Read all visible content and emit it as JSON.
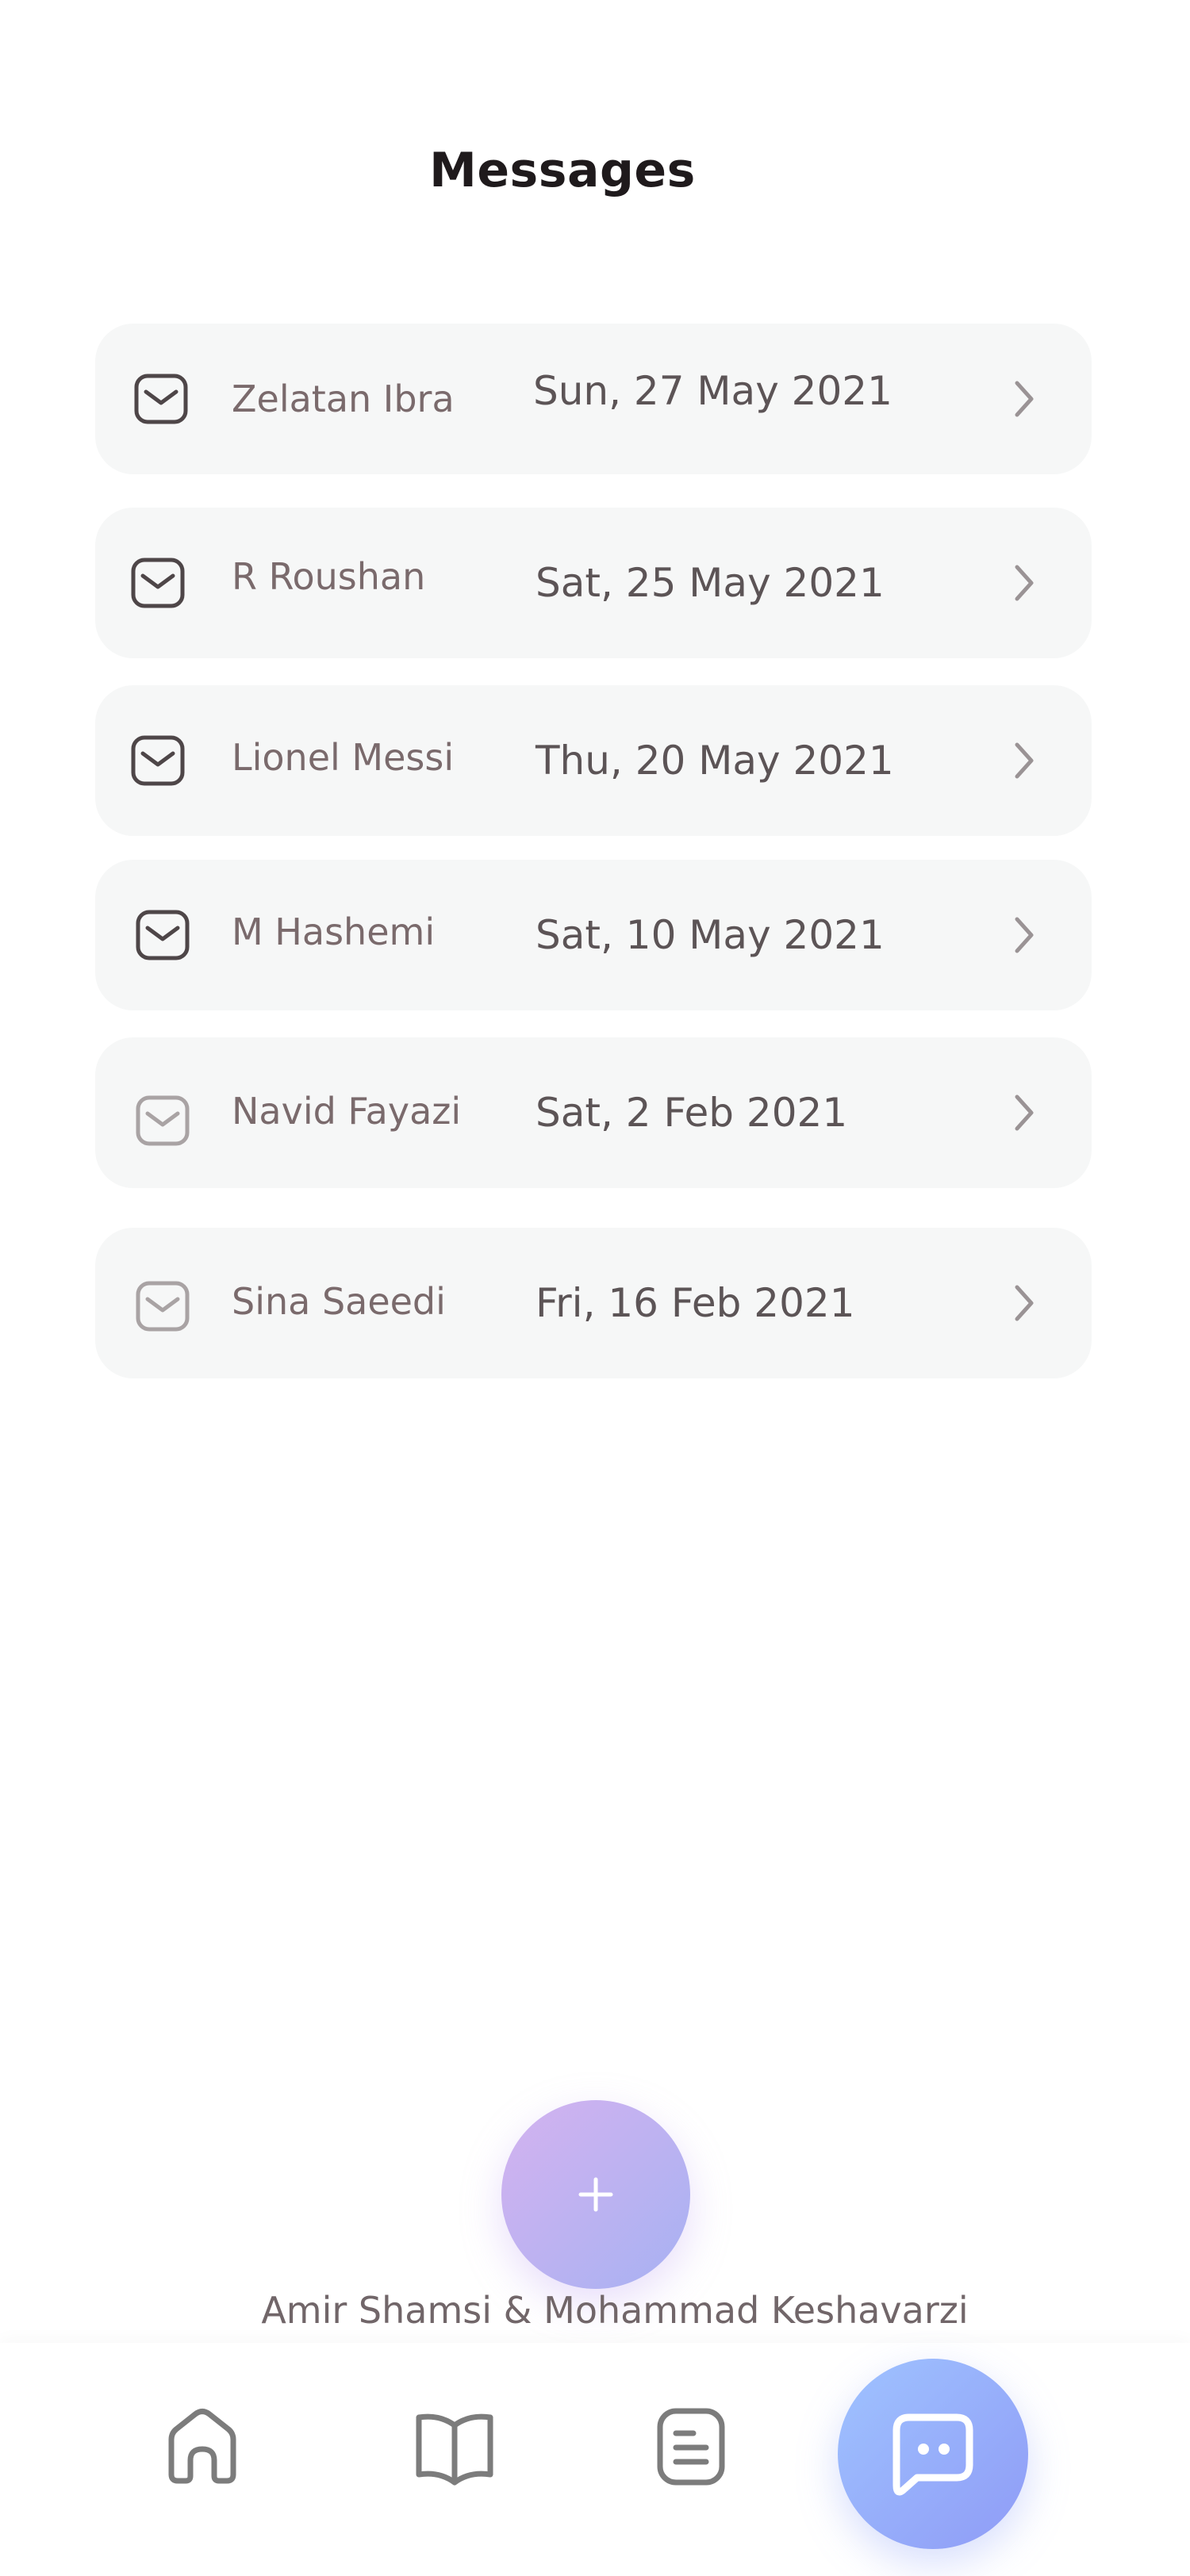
{
  "header": {
    "title": "Messages"
  },
  "messages": [
    {
      "sender": "Zelatan Ibra",
      "date": "Sun, 27 May 2021",
      "read": false,
      "icon": "mail-icon"
    },
    {
      "sender": "R Roushan",
      "date": "Sat, 25 May 2021",
      "read": false,
      "icon": "mail-icon"
    },
    {
      "sender": "Lionel Messi",
      "date": "Thu, 20 May 2021",
      "read": false,
      "icon": "mail-icon"
    },
    {
      "sender": "M Hashemi",
      "date": "Sat, 10 May 2021",
      "read": false,
      "icon": "mail-icon"
    },
    {
      "sender": "Navid Fayazi",
      "date": "Sat, 2 Feb 2021",
      "read": true,
      "icon": "mail-icon"
    },
    {
      "sender": "Sina Saeedi",
      "date": "Fri, 16 Feb 2021",
      "read": true,
      "icon": "mail-icon"
    }
  ],
  "fab": {
    "icon": "plus-icon"
  },
  "footer": {
    "credits": "Amir Shamsi & Mohammad Keshavarzi"
  },
  "bottom_nav": {
    "items": [
      {
        "icon": "home-icon",
        "active": false
      },
      {
        "icon": "book-icon",
        "active": false
      },
      {
        "icon": "document-icon",
        "active": false
      },
      {
        "icon": "chat-icon",
        "active": true
      }
    ]
  },
  "colors": {
    "unread_icon": "#4e4648",
    "read_icon": "#a9a3a4",
    "card_background": "#f6f7f7",
    "fab_gradient_start": "#d4b3f0",
    "fab_gradient_end": "#a7b1f2",
    "nav_active_gradient_start": "#9fc3ff",
    "nav_active_gradient_end": "#8f9bf6"
  }
}
